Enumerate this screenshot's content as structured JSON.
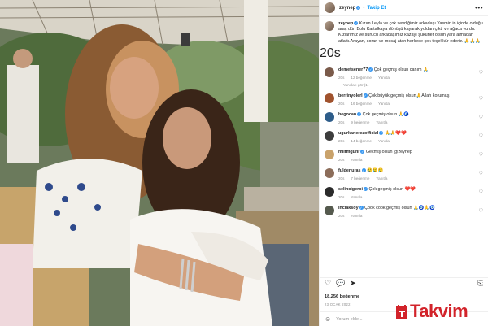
{
  "header": {
    "username": "zeynep",
    "follow": "Takip Et",
    "more": "•••"
  },
  "caption": {
    "username": "zeynep",
    "text": "Kızım Leyla ve çok sevdiğimiz arkadaşı Yasmin in içinde olduğu araç dün Bolu Kartalkaya dönüşü kayarak yoldan çıktı ve ağaca vurdu. Kızlarımız ve sürücü arkadaşımız kazayı şükürler olsun yara almadan atlattı.Arayan, soran ve mesaj atan herkese çok teşekkür ederiz. 🙏🙏🙏",
    "time": "20s"
  },
  "comments": [
    {
      "user": "demetsener77",
      "text": "Çok geçmiş olsun canım 🙏",
      "time": "20s",
      "likes": "12 beğenme",
      "reply": "Yanıtla",
      "color": "#7a5a4a",
      "replies": "Yanıtları gör (1)"
    },
    {
      "user": "berrinyolerl",
      "text": "Çok büyük geçmiş olsun🙏Allah korumuş",
      "time": "20s",
      "likes": "16 beğenme",
      "reply": "Yanıtla",
      "color": "#a0522d"
    },
    {
      "user": "begocan",
      "text": "Çok geçmiş olsun 🙏🧿",
      "time": "20s",
      "likes": "9 beğenme",
      "reply": "Yanıtla",
      "color": "#2e5d8a"
    },
    {
      "user": "ugurkanerezofficial",
      "text": "🙏🙏❤️❤️",
      "time": "20s",
      "likes": "14 beğenme",
      "reply": "Yanıtla",
      "color": "#3d3d3d"
    },
    {
      "user": "miltmgunr",
      "text": "Geçmiş olsun @zeynep",
      "time": "20s",
      "likes": "",
      "reply": "Yanıtla",
      "color": "#c9a26b"
    },
    {
      "user": "fuldenuras",
      "text": "😢😢😢",
      "time": "20s",
      "likes": "7 beğenme",
      "reply": "Yanıtla",
      "color": "#8c6d5a"
    },
    {
      "user": "selincigeroi",
      "text": "Çok geçmiş olsun ❤️❤️",
      "time": "20s",
      "likes": "",
      "reply": "Yanıtla",
      "color": "#2b2b2b"
    },
    {
      "user": "inciaksoy",
      "text": "Çook çook geçmiş olsun 🙏🧿🙏🧿",
      "time": "20s",
      "likes": "",
      "reply": "Yanıtla",
      "color": "#555a4e"
    }
  ],
  "likes": "18.256 beğenme",
  "date": "23 OCAK 2022",
  "add_comment": "Yorum ekle...",
  "watermark": "Takvim",
  "colors": {
    "accent": "#0095f6",
    "verified": "#3897f0",
    "brand": "#d2232a"
  }
}
